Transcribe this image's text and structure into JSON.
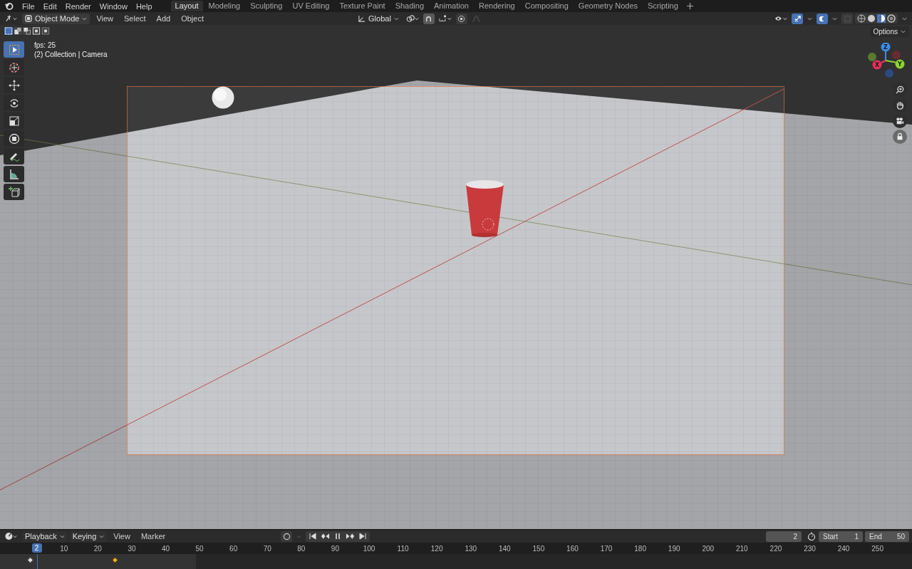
{
  "menu": [
    "File",
    "Edit",
    "Render",
    "Window",
    "Help"
  ],
  "workspaces": [
    {
      "label": "Layout",
      "selected": true
    },
    {
      "label": "Modeling",
      "selected": false
    },
    {
      "label": "Sculpting",
      "selected": false
    },
    {
      "label": "UV Editing",
      "selected": false
    },
    {
      "label": "Texture Paint",
      "selected": false
    },
    {
      "label": "Shading",
      "selected": false
    },
    {
      "label": "Animation",
      "selected": false
    },
    {
      "label": "Rendering",
      "selected": false
    },
    {
      "label": "Compositing",
      "selected": false
    },
    {
      "label": "Geometry Nodes",
      "selected": false
    },
    {
      "label": "Scripting",
      "selected": false
    }
  ],
  "header": {
    "mode": "Object Mode",
    "menus": [
      "View",
      "Select",
      "Add",
      "Object"
    ],
    "orientation": "Global",
    "options": "Options"
  },
  "viewport": {
    "overlay_text": [
      "fps: 25",
      "(2) Collection | Camera"
    ],
    "tools": [
      {
        "kind": "select",
        "selected": true
      },
      {
        "kind": "cursor",
        "selected": false
      },
      {
        "kind": "move",
        "selected": false
      },
      {
        "kind": "rotate",
        "selected": false
      },
      {
        "kind": "scale",
        "selected": false
      },
      {
        "kind": "transform",
        "selected": false
      },
      {
        "kind": "annotate",
        "selected": false
      },
      {
        "kind": "measure",
        "selected": false
      },
      {
        "kind": "add-cube",
        "selected": false
      }
    ],
    "gizmo": {
      "z": "Z",
      "x": "X",
      "y": "Y"
    }
  },
  "timeline": {
    "menus": [
      "Playback",
      "Keying",
      "View",
      "Marker"
    ],
    "current_frame": "2",
    "playhead_frame": "2",
    "start_label": "Start",
    "start": "1",
    "end_label": "End",
    "end": "50",
    "ticks": [
      "10",
      "20",
      "30",
      "40",
      "50",
      "60",
      "70",
      "80",
      "90",
      "100",
      "110",
      "120",
      "130",
      "140",
      "150",
      "160",
      "170",
      "180",
      "190",
      "200",
      "210",
      "220",
      "230",
      "240",
      "250"
    ],
    "keyframes": [
      {
        "selected": false
      },
      {
        "selected": true
      }
    ]
  }
}
